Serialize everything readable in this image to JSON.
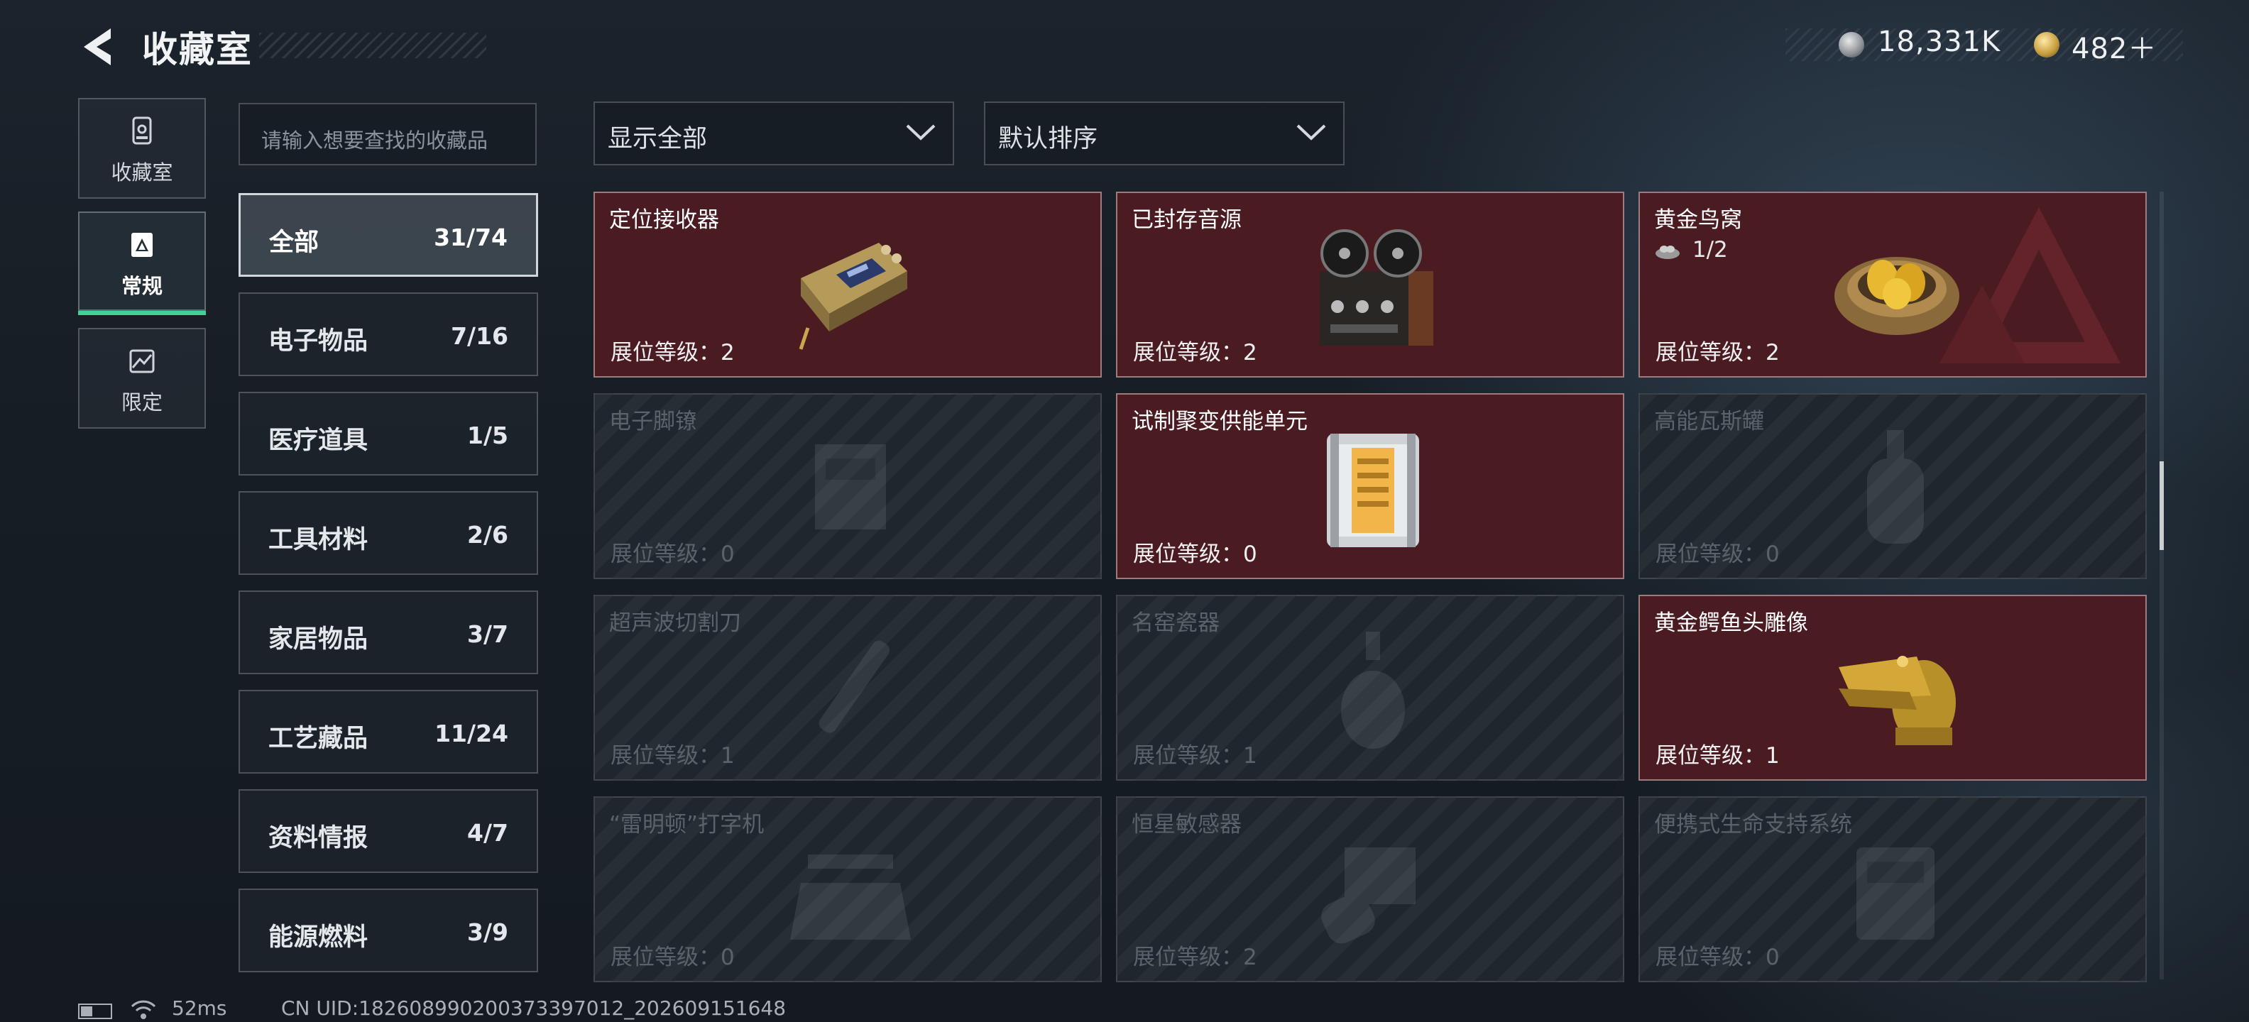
{
  "header": {
    "title": "收藏室",
    "currency_silver": "18,331K",
    "currency_gold": "482＋"
  },
  "rail": {
    "items": [
      {
        "label": "收藏室"
      },
      {
        "label": "常规"
      },
      {
        "label": "限定"
      }
    ]
  },
  "search": {
    "placeholder": "请输入想要查找的收藏品"
  },
  "filters": {
    "display": "显示全部",
    "sort": "默认排序"
  },
  "categories": [
    {
      "name": "全部",
      "count": "31/74"
    },
    {
      "name": "电子物品",
      "count": "7/16"
    },
    {
      "name": "医疗道具",
      "count": "1/5"
    },
    {
      "name": "工具材料",
      "count": "2/6"
    },
    {
      "name": "家居物品",
      "count": "3/7"
    },
    {
      "name": "工艺藏品",
      "count": "11/24"
    },
    {
      "name": "资料情报",
      "count": "4/7"
    },
    {
      "name": "能源燃料",
      "count": "3/9"
    }
  ],
  "items": [
    {
      "name": "定位接收器",
      "level": "展位等级：2",
      "owned": true
    },
    {
      "name": "已封存音源",
      "level": "展位等级：2",
      "owned": true
    },
    {
      "name": "黄金鸟窝",
      "level": "展位等级：2",
      "owned": true,
      "progress": "1/2"
    },
    {
      "name": "电子脚镣",
      "level": "展位等级：0",
      "owned": false
    },
    {
      "name": "试制聚变供能单元",
      "level": "展位等级：0",
      "owned": true
    },
    {
      "name": "高能瓦斯罐",
      "level": "展位等级：0",
      "owned": false
    },
    {
      "name": "超声波切割刀",
      "level": "展位等级：1",
      "owned": false
    },
    {
      "name": "名窑瓷器",
      "level": "展位等级：1",
      "owned": false
    },
    {
      "name": "黄金鳄鱼头雕像",
      "level": "展位等级：1",
      "owned": true
    },
    {
      "name": "“雷明顿”打字机",
      "level": "展位等级：0",
      "owned": false
    },
    {
      "name": "恒星敏感器",
      "level": "展位等级：2",
      "owned": false
    },
    {
      "name": "便携式生命支持系统",
      "level": "展位等级：0",
      "owned": false
    }
  ],
  "status": {
    "ping": "52ms",
    "uid": "CN UID:1826089902003733970​12_202609151648"
  },
  "colors": {
    "accent_green": "#3fd39a",
    "owned_card": "#4a1c22",
    "locked_card": "#1f262d"
  }
}
